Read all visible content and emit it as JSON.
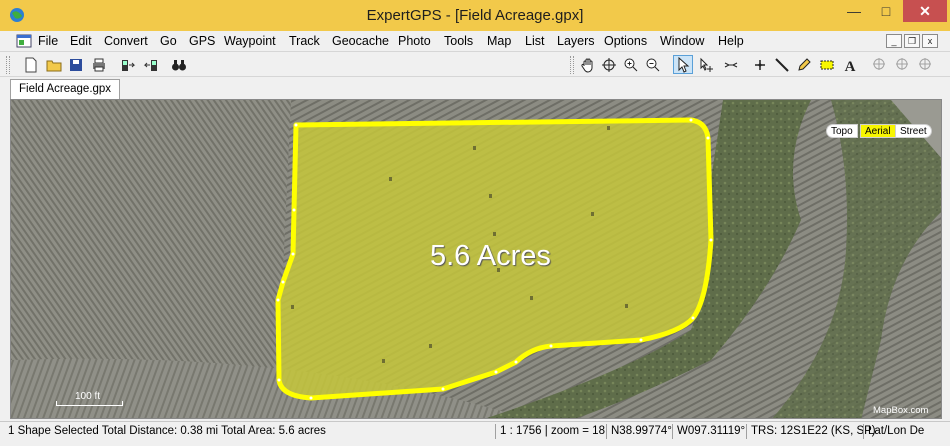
{
  "window": {
    "title": "ExpertGPS - [Field Acreage.gpx]"
  },
  "menu": [
    "File",
    "Edit",
    "Convert",
    "Go",
    "GPS",
    "Waypoint",
    "Track",
    "Geocache",
    "Photo",
    "Tools",
    "Map",
    "List",
    "Layers",
    "Options",
    "Window",
    "Help"
  ],
  "document_tab": "Field Acreage.gpx",
  "map": {
    "area_label": "5.6 Acres",
    "map_types": [
      "Topo",
      "Aerial",
      "Street"
    ],
    "selected_map_type": "Aerial",
    "scale_label": "100 ft",
    "attribution": "MapBox.com",
    "shape_fill_color": "#c5c73b",
    "shape_outline_color": "#ffff00"
  },
  "status": {
    "message": "1 Shape Selected Total Distance: 0.38 mi Total Area: 5.6 acres",
    "scale": "1 : 1756 | zoom = 18",
    "latitude": "N38.99774°",
    "longitude": "W097.31119°",
    "trs": "TRS: 12S1E22 (KS, SP)",
    "coord_format": "Lat/Lon De"
  }
}
